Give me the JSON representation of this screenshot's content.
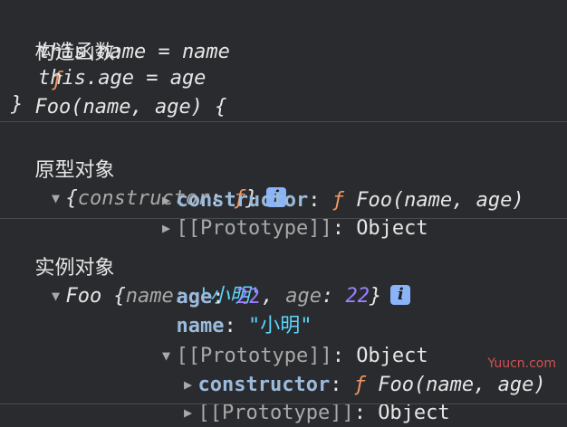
{
  "section1": {
    "label": "构造函数:",
    "fn_keyword": "ƒ",
    "signature": "Foo(name, age) {",
    "body_line1": "this.name = name",
    "body_line2": "this.age = age",
    "closing": "}"
  },
  "section2": {
    "label": "原型对象",
    "summary_open": "{",
    "summary_key": "constructor",
    "summary_colon": ": ",
    "summary_fn": "ƒ",
    "summary_close": "}",
    "info": "i",
    "rows": [
      {
        "key": "constructor",
        "colon": ": ",
        "fn": "ƒ",
        "value": "Foo(name, age)"
      },
      {
        "key": "[[Prototype]]",
        "colon": ": ",
        "value": "Object"
      }
    ]
  },
  "section3": {
    "label": "实例对象",
    "summary_name": "Foo",
    "summary_open": " {",
    "summary_k1": "name",
    "summary_colon1": ": ",
    "summary_v1": "'小明'",
    "summary_comma": ", ",
    "summary_k2": "age",
    "summary_colon2": ": ",
    "summary_v2": "22",
    "summary_close": "}",
    "info": "i",
    "age_key": "age",
    "age_colon": ": ",
    "age_value": "22",
    "name_key": "name",
    "name_colon": ": ",
    "name_value": "\"小明\"",
    "proto_key": "[[Prototype]]",
    "proto_colon": ": ",
    "proto_value": "Object",
    "nested": [
      {
        "key": "constructor",
        "colon": ": ",
        "fn": "ƒ",
        "value": "Foo(name, age)"
      },
      {
        "key": "[[Prototype]]",
        "colon": ": ",
        "value": "Object"
      }
    ]
  },
  "arrows": {
    "collapsed": "▶",
    "expanded": "▼"
  },
  "watermark": "Yuucn.com"
}
